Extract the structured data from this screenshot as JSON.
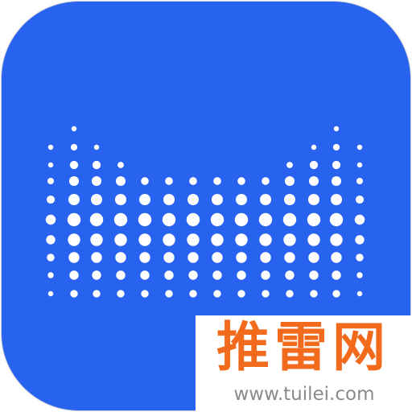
{
  "icon": {
    "name": "dotted-cat-head-icon",
    "background_color": "#2863f0",
    "dot_color": "#ffffff"
  },
  "watermark": {
    "title": "推雷网",
    "url": "www.tuilei.com",
    "title_color": "#f26a1b",
    "url_color": "#8a8a8a"
  }
}
